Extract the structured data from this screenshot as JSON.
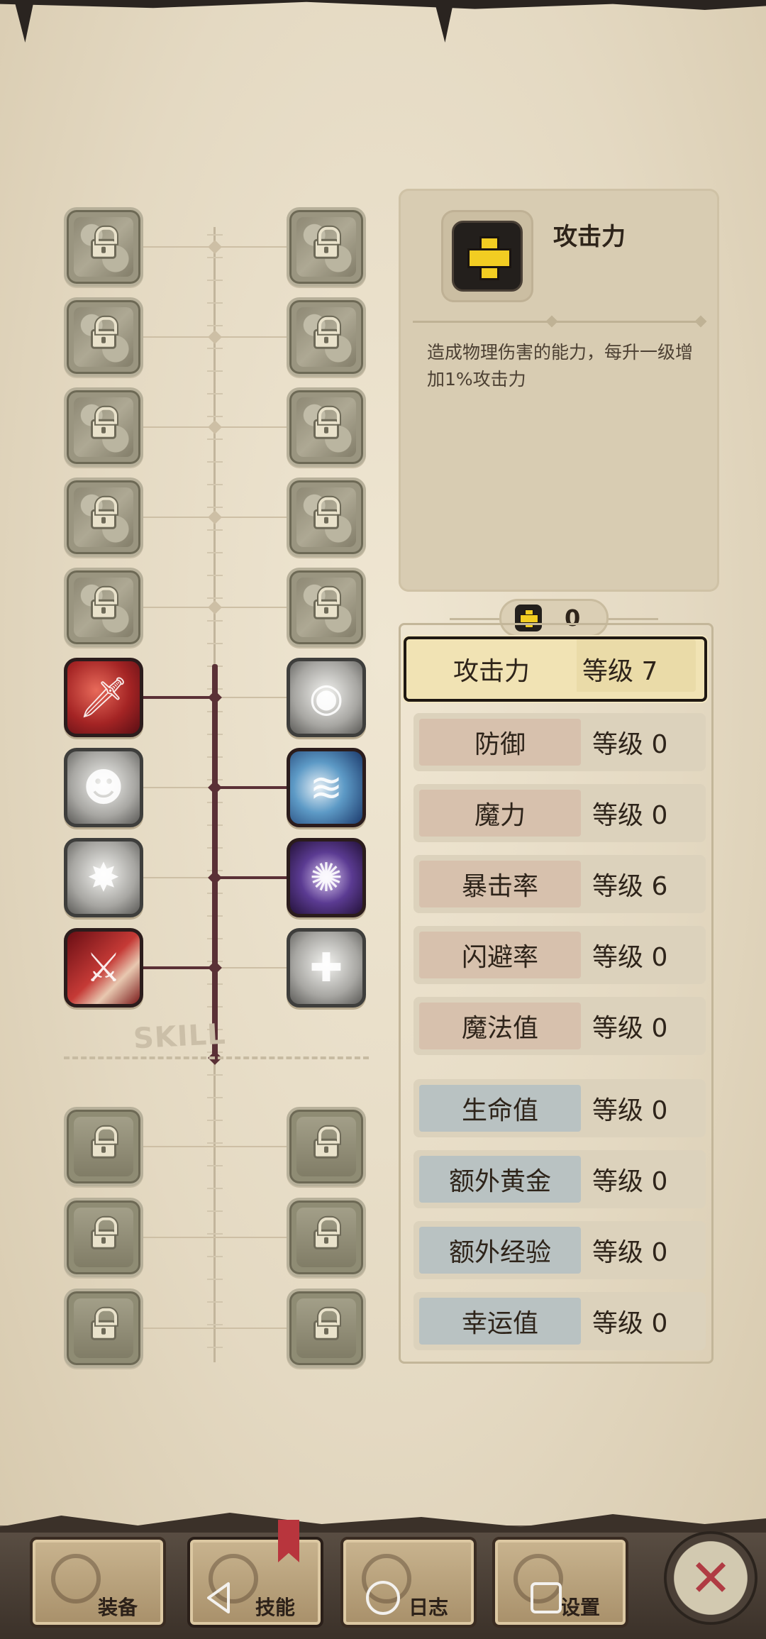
{
  "detail": {
    "title": "攻击力",
    "description": "造成物理伤害的能力，每升一级增加1%攻击力",
    "icon": "plus-icon"
  },
  "points": {
    "icon": "plus-icon",
    "value": "0"
  },
  "stats": [
    {
      "name": "攻击力",
      "level": "等级 7",
      "group": "attack",
      "selected": true
    },
    {
      "name": "防御",
      "level": "等级 0",
      "group": "attack"
    },
    {
      "name": "魔力",
      "level": "等级 0",
      "group": "attack"
    },
    {
      "name": "暴击率",
      "level": "等级 6",
      "group": "attack"
    },
    {
      "name": "闪避率",
      "level": "等级 0",
      "group": "attack"
    },
    {
      "name": "魔法值",
      "level": "等级 0",
      "group": "attack"
    },
    {
      "name": "生命值",
      "level": "等级 0",
      "group": "support"
    },
    {
      "name": "额外黄金",
      "level": "等级 0",
      "group": "support"
    },
    {
      "name": "额外经验",
      "level": "等级 0",
      "group": "support"
    },
    {
      "name": "幸运值",
      "level": "等级 0",
      "group": "support"
    }
  ],
  "skill_tree": {
    "divider_label": "SKILL",
    "left_column": [
      "locked",
      "locked",
      "locked",
      "locked",
      "locked",
      "sword-skill-icon",
      "ghost-skill-icon",
      "beast-skill-icon",
      "blade-skill-icon"
    ],
    "right_column": [
      "locked",
      "locked",
      "locked",
      "locked",
      "locked",
      "eye-skill-icon",
      "wind-slash-skill-icon",
      "vortex-skill-icon",
      "spirit-skill-icon"
    ],
    "lower_slots": 6
  },
  "tabs": [
    {
      "label": "装备",
      "icon": "gear-equipment-icon"
    },
    {
      "label": "技能",
      "icon": "skill-icon",
      "active": true
    },
    {
      "label": "日志",
      "icon": "log-icon"
    },
    {
      "label": "设置",
      "icon": "settings-icon"
    }
  ],
  "close": {
    "label": "✕"
  },
  "colors": {
    "accent": "#f2cd22",
    "active_line": "#5a3036",
    "close_red": "#b03b43"
  }
}
